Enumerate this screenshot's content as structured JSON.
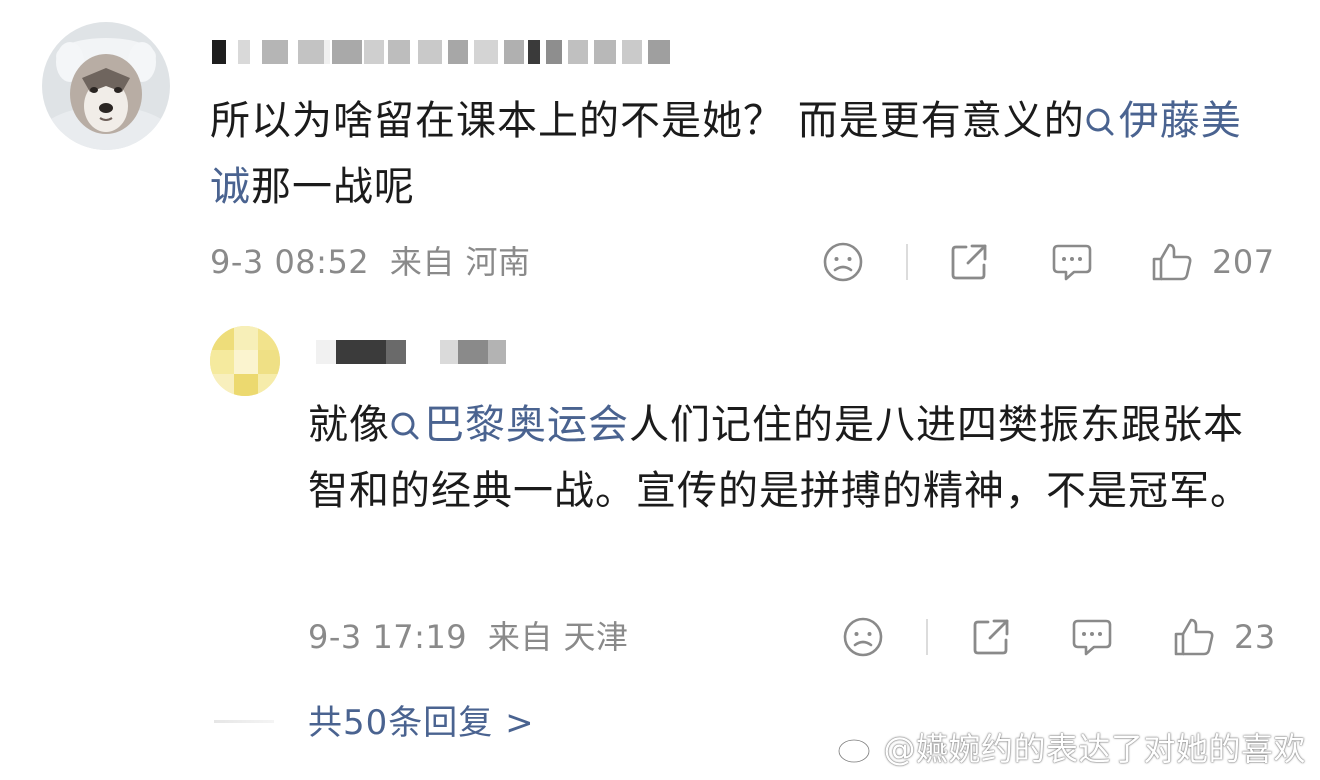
{
  "comment": {
    "text_before_topic": "所以为啥留在课本上的不是她？ 而是更有意义的",
    "topic": "伊藤美诚",
    "text_after_topic": "那一战呢",
    "time": "9-3 08:52",
    "location": "来自 河南",
    "likes": "207"
  },
  "reply": {
    "text_before_topic": "就像",
    "topic": "巴黎奥运会",
    "text_after_topic": "人们记住的是八进四樊振东跟张本智和的经典一战。宣传的是拼搏的精神，不是冠军。",
    "time": "9-3 17:19",
    "location": "来自 天津",
    "likes": "23"
  },
  "more_replies": "共50条回复 >",
  "watermark": "@嬿婉约的表达了对她的喜欢",
  "colors": {
    "link": "#4a6390",
    "meta": "#8a8a8a",
    "text": "#1b1b1b"
  },
  "icons": [
    "dislike-icon",
    "share-icon",
    "comment-icon",
    "thumbs-up-icon",
    "search-topic-icon",
    "weibo-logo-icon"
  ]
}
